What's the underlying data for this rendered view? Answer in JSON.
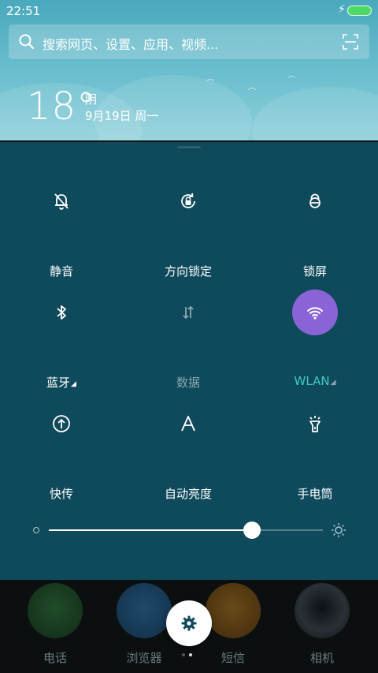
{
  "status_bar": {
    "time": "22:51"
  },
  "search": {
    "placeholder": "搜索网页、设置、应用、视频..."
  },
  "weather": {
    "temperature": "18°",
    "condition": "阴",
    "date": "9月19日 周一"
  },
  "toggles": [
    {
      "label": "静音",
      "icon": "bell-off-icon",
      "state": "off"
    },
    {
      "label": "方向锁定",
      "icon": "rotation-lock-icon",
      "state": "off"
    },
    {
      "label": "锁屏",
      "icon": "lock-icon",
      "state": "off"
    },
    {
      "label": "蓝牙",
      "icon": "bluetooth-icon",
      "state": "off",
      "has_submenu": true
    },
    {
      "label": "数据",
      "icon": "data-arrows-icon",
      "state": "disabled"
    },
    {
      "label": "WLAN",
      "icon": "wifi-icon",
      "state": "on",
      "has_submenu": true
    },
    {
      "label": "快传",
      "icon": "quick-share-icon",
      "state": "off"
    },
    {
      "label": "自动亮度",
      "icon": "auto-brightness-icon",
      "state": "off"
    },
    {
      "label": "手电筒",
      "icon": "flashlight-icon",
      "state": "off"
    }
  ],
  "brightness": {
    "level": 0.74
  },
  "dock": {
    "apps": [
      {
        "label": "电话",
        "icon": "phone-icon"
      },
      {
        "label": "浏览器",
        "icon": "browser-icon"
      },
      {
        "label": "短信",
        "icon": "messages-icon"
      },
      {
        "label": "相机",
        "icon": "camera-icon"
      }
    ],
    "settings_icon": "gear-icon",
    "page_indicator": {
      "pages": 2,
      "current": 2
    }
  },
  "colors": {
    "panel_bg": "#0f4a5c",
    "active_toggle": "#8a64d6",
    "accent_label": "#3fc9c4",
    "weather_bg": "#6cbfcf"
  }
}
